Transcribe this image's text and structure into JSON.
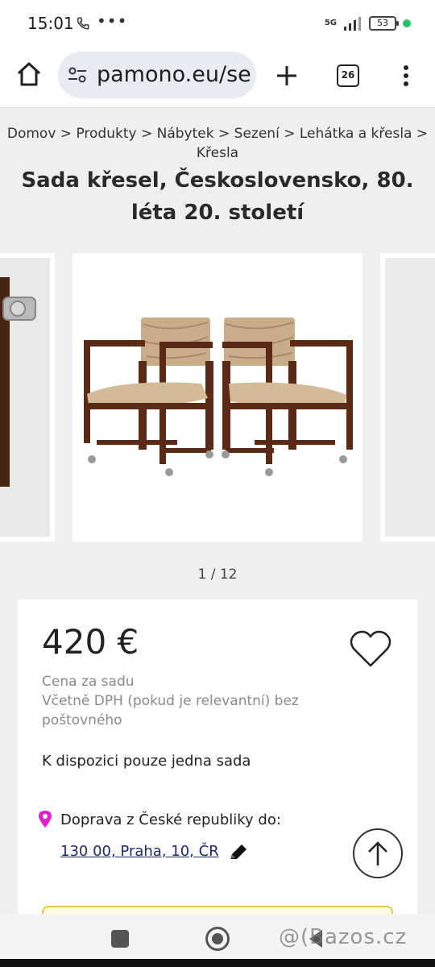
{
  "status_bar": {
    "time": "15:01",
    "dots": "•••",
    "network": "5G",
    "battery": "53"
  },
  "browser": {
    "url": "pamono.eu/se",
    "tab_count": "26"
  },
  "breadcrumb": {
    "items": [
      "Domov",
      "Produkty",
      "Nábytek",
      "Sezení",
      "Lehátka a křesla",
      "Křesla"
    ],
    "separator": " > "
  },
  "product": {
    "title": "Sada křesel, Československo, 80. léta 20. století",
    "gallery_counter": "1 / 12",
    "price": "420 €",
    "price_unit": "Cena za sadu",
    "price_note": "Včetně DPH (pokud je relevantní) bez poštovného",
    "availability": "K dispozici pouze jedna sada",
    "shipping_label": "Doprava z České republiky do:",
    "shipping_destination": "130 00, Praha, 10, ČR"
  },
  "watermark": "@(Bazos.cz",
  "colors": {
    "pin": "#e020c8",
    "link": "#1d2a6e",
    "chair_wood": "#5a2a16",
    "upholstery": "#c9ad8a",
    "cta_border": "#e8c94a"
  }
}
